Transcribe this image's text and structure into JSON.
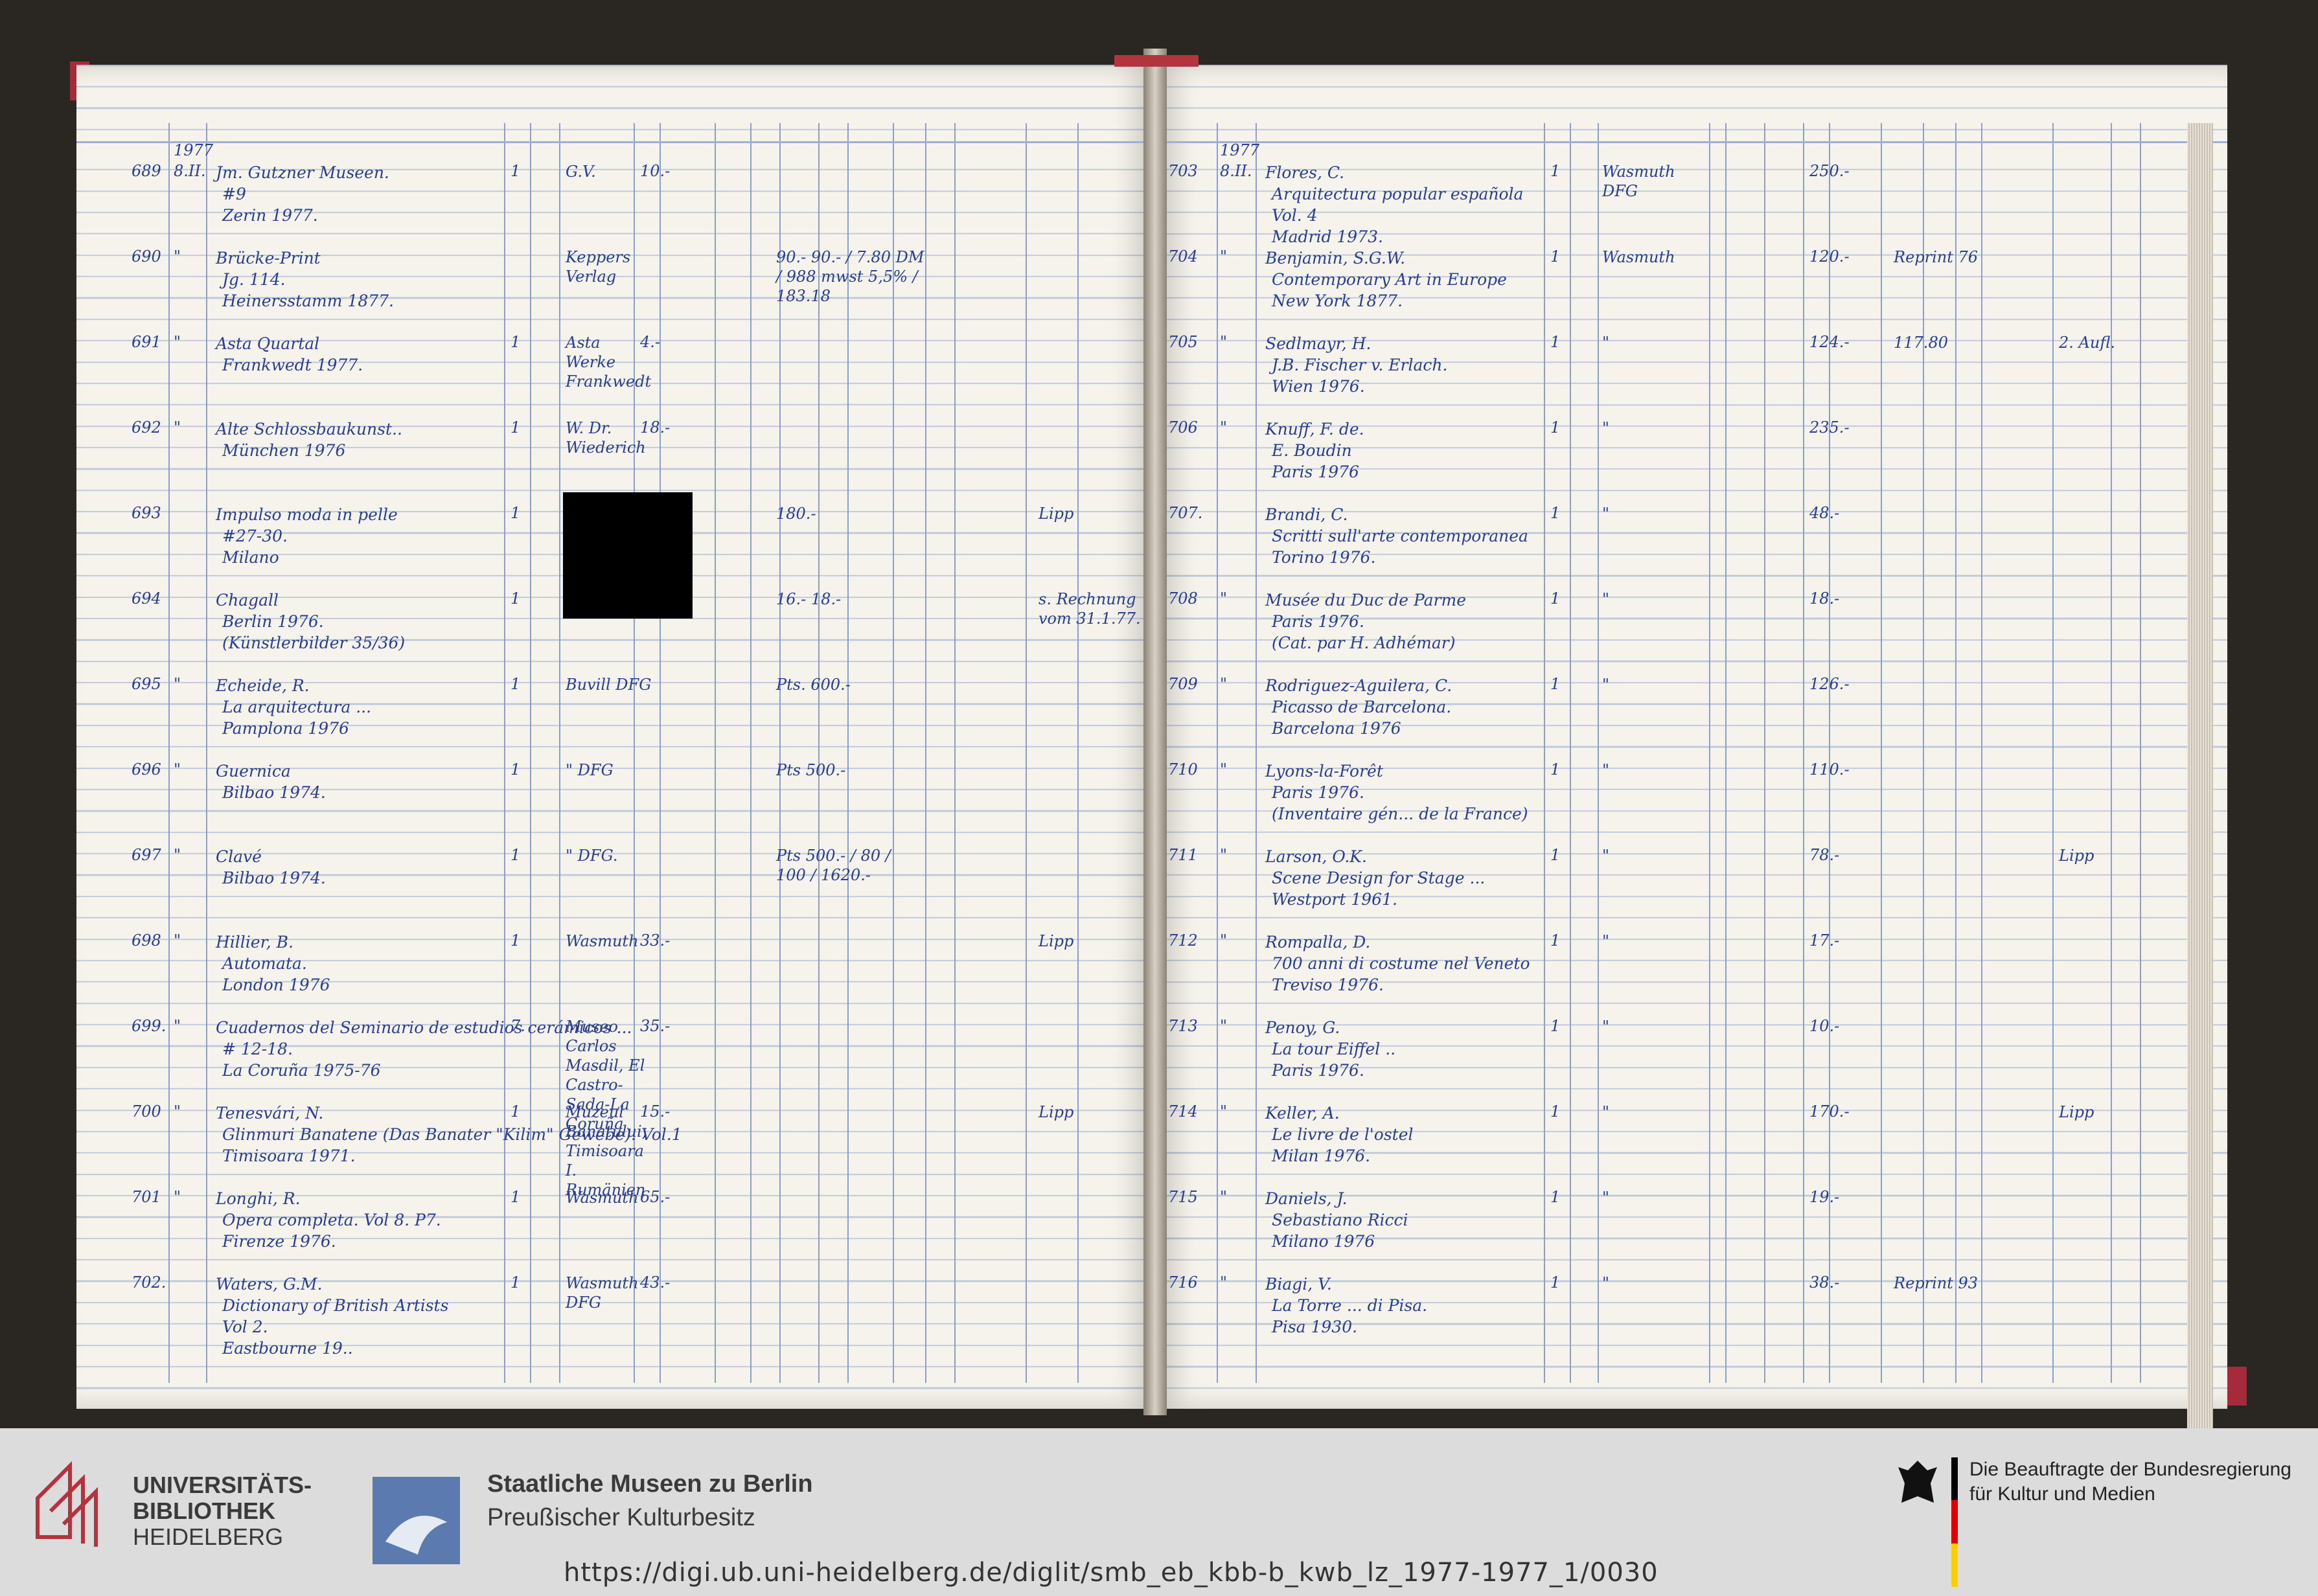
{
  "left_page": {
    "header_year": "1977",
    "entries": [
      {
        "no": "689",
        "date": "8.II.",
        "text": [
          "Jm. Gutzner Museen.",
          "#9",
          "Zerin 1977."
        ],
        "count": "1",
        "source": "G.V.",
        "price": "10.-",
        "extra": "",
        "note": ""
      },
      {
        "no": "690",
        "date": "\"",
        "text": [
          "Brücke-Print",
          "Jg. 114.",
          "Heinersstamm 1877."
        ],
        "count": "",
        "source": "Keppers Verlag",
        "price": "",
        "extra": "90.-  90.- / 7.80 DM / 988 mwst 5,5% / 183.18",
        "note": ""
      },
      {
        "no": "691",
        "date": "\"",
        "text": [
          "Asta Quartal",
          "Frankwedt 1977."
        ],
        "count": "1",
        "source": "Asta Werke Frankwedt",
        "price": "4.-",
        "extra": "",
        "note": ""
      },
      {
        "no": "692",
        "date": "\"",
        "text": [
          "Alte Schlossbaukunst..",
          "München 1976"
        ],
        "count": "1",
        "source": "W. Dr. Wiederich",
        "price": "18.-",
        "extra": "",
        "note": ""
      },
      {
        "no": "693",
        "date": "",
        "text": [
          "Impulso moda in pelle",
          "#27-30.",
          "Milano"
        ],
        "count": "1",
        "source": "",
        "price": "",
        "extra": "180.-",
        "note": "Lipp"
      },
      {
        "no": "694",
        "date": "",
        "text": [
          "Chagall",
          "Berlin 1976.",
          "(Künstlerbilder 35/36)"
        ],
        "count": "1",
        "source": "",
        "price": "",
        "extra": "16.-  18.-",
        "note": "s. Rechnung vom 31.1.77."
      },
      {
        "no": "695",
        "date": "\"",
        "text": [
          "Echeide, R.",
          "La arquitectura ...",
          "Pamplona 1976"
        ],
        "count": "1",
        "source": "Buvill DFG",
        "price": "",
        "extra": "Pts. 600.-",
        "note": ""
      },
      {
        "no": "696",
        "date": "\"",
        "text": [
          "Guernica",
          "Bilbao 1974."
        ],
        "count": "1",
        "source": "\" DFG",
        "price": "",
        "extra": "Pts 500.-",
        "note": ""
      },
      {
        "no": "697",
        "date": "\"",
        "text": [
          "Clavé",
          "Bilbao 1974."
        ],
        "count": "1",
        "source": "\" DFG.",
        "price": "",
        "extra": "Pts 500.- / 80 / 100 / 1620.-",
        "note": ""
      },
      {
        "no": "698",
        "date": "\"",
        "text": [
          "Hillier, B.",
          "Automata.",
          "London 1976"
        ],
        "count": "1",
        "source": "Wasmuth",
        "price": "33.-",
        "extra": "",
        "note": "Lipp"
      },
      {
        "no": "699.",
        "date": "\"",
        "text": [
          "Cuadernos del Seminario de estudios cerámicos ...",
          "# 12-18.",
          "La Coruña 1975-76"
        ],
        "count": "7.",
        "source": "Museo Carlos Masdil, El Castro-Sada-La Coruña",
        "price": "35.-",
        "extra": "",
        "note": ""
      },
      {
        "no": "700",
        "date": "\"",
        "text": [
          "Tenesvári, N.",
          "Glinmuri Banatene (Das Banater \"Kilim\" Gewebe). Vol.1",
          "Timisoara 1971."
        ],
        "count": "1",
        "source": "Muzeul Banatului, Timisoara I. Rumänien",
        "price": "15.-",
        "extra": "",
        "note": "Lipp"
      },
      {
        "no": "701",
        "date": "\"",
        "text": [
          "Longhi, R.",
          "Opera completa. Vol 8. P7.",
          "Firenze 1976."
        ],
        "count": "1",
        "source": "Wasmuth",
        "price": "65.-",
        "extra": "",
        "note": ""
      },
      {
        "no": "702.",
        "date": "",
        "text": [
          "Waters, G.M.",
          "Dictionary of British Artists",
          "Vol 2.",
          "Eastbourne 19.."
        ],
        "count": "1",
        "source": "Wasmuth DFG",
        "price": "43.-",
        "extra": "",
        "note": ""
      }
    ]
  },
  "right_page": {
    "header_year": "1977",
    "entries": [
      {
        "no": "703",
        "date": "8.II.",
        "text": [
          "Flores, C.",
          "Arquitectura popular española",
          "Vol. 4",
          "Madrid 1973."
        ],
        "count": "1",
        "source": "Wasmuth DFG",
        "price": "250.-",
        "extra": "",
        "note": ""
      },
      {
        "no": "704",
        "date": "\"",
        "text": [
          "Benjamin, S.G.W.",
          "Contemporary Art in Europe",
          "New York 1877."
        ],
        "count": "1",
        "source": "Wasmuth",
        "price": "120.-",
        "extra": "Reprint 76",
        "note": ""
      },
      {
        "no": "705",
        "date": "\"",
        "text": [
          "Sedlmayr, H.",
          "J.B. Fischer v. Erlach.",
          "Wien 1976."
        ],
        "count": "1",
        "source": "\"",
        "price": "124.-",
        "extra": "117.80",
        "note": "2. Aufl."
      },
      {
        "no": "706",
        "date": "\"",
        "text": [
          "Knuff, F. de.",
          "E. Boudin",
          "Paris 1976"
        ],
        "count": "1",
        "source": "\"",
        "price": "235.-",
        "extra": "",
        "note": ""
      },
      {
        "no": "707.",
        "date": "",
        "text": [
          "Brandi, C.",
          "Scritti sull'arte contemporanea",
          "Torino 1976."
        ],
        "count": "1",
        "source": "\"",
        "price": "48.-",
        "extra": "",
        "note": ""
      },
      {
        "no": "708",
        "date": "\"",
        "text": [
          "Musée du Duc de Parme",
          "Paris 1976.",
          "(Cat. par H. Adhémar)"
        ],
        "count": "1",
        "source": "\"",
        "price": "18.-",
        "extra": "",
        "note": ""
      },
      {
        "no": "709",
        "date": "\"",
        "text": [
          "Rodriguez-Aguilera, C.",
          "Picasso de Barcelona.",
          "Barcelona 1976"
        ],
        "count": "1",
        "source": "\"",
        "price": "126.-",
        "extra": "",
        "note": ""
      },
      {
        "no": "710",
        "date": "\"",
        "text": [
          "Lyons-la-Forêt",
          "Paris 1976.",
          "(Inventaire gén... de la France)"
        ],
        "count": "1",
        "source": "\"",
        "price": "110.-",
        "extra": "",
        "note": ""
      },
      {
        "no": "711",
        "date": "\"",
        "text": [
          "Larson, O.K.",
          "Scene Design for Stage ...",
          "Westport 1961."
        ],
        "count": "1",
        "source": "\"",
        "price": "78.-",
        "extra": "",
        "note": "Lipp"
      },
      {
        "no": "712",
        "date": "\"",
        "text": [
          "Rompalla, D.",
          "700 anni di costume nel Veneto",
          "Treviso 1976."
        ],
        "count": "1",
        "source": "\"",
        "price": "17.-",
        "extra": "",
        "note": ""
      },
      {
        "no": "713",
        "date": "\"",
        "text": [
          "Penoy, G.",
          "La tour Eiffel ..",
          "Paris 1976."
        ],
        "count": "1",
        "source": "\"",
        "price": "10.-",
        "extra": "",
        "note": ""
      },
      {
        "no": "714",
        "date": "\"",
        "text": [
          "Keller, A.",
          "Le livre de l'ostel",
          "Milan 1976."
        ],
        "count": "1",
        "source": "\"",
        "price": "170.-",
        "extra": "",
        "note": "Lipp"
      },
      {
        "no": "715",
        "date": "\"",
        "text": [
          "Daniels, J.",
          "Sebastiano Ricci",
          "Milano 1976"
        ],
        "count": "1",
        "source": "\"",
        "price": "19.-",
        "extra": "",
        "note": ""
      },
      {
        "no": "716",
        "date": "\"",
        "text": [
          "Biagi, V.",
          "La Torre ... di Pisa.",
          "Pisa 1930."
        ],
        "count": "1",
        "source": "\"",
        "price": "38.-",
        "extra": "Reprint 93",
        "note": ""
      }
    ]
  },
  "footer": {
    "logo1_line1": "UNIVERSITÄTS-",
    "logo1_line2": "BIBLIOTHEK",
    "logo1_line3": "HEIDELBERG",
    "logo2_line1": "Staatliche Museen zu Berlin",
    "logo2_line2": "Preußischer Kulturbesitz",
    "logo3_line1": "Die Beauftragte der Bundesregierung",
    "logo3_line2": "für Kultur und Medien",
    "url": "https://digi.ub.uni-heidelberg.de/diglit/smb_eb_kbb-b_kwb_lz_1977-1977_1/0030"
  },
  "colors": {
    "ink": "#2a3f8f",
    "paper": "#f6f3ec",
    "rule": "#8aa0c8",
    "binding": "#a52b3a"
  }
}
